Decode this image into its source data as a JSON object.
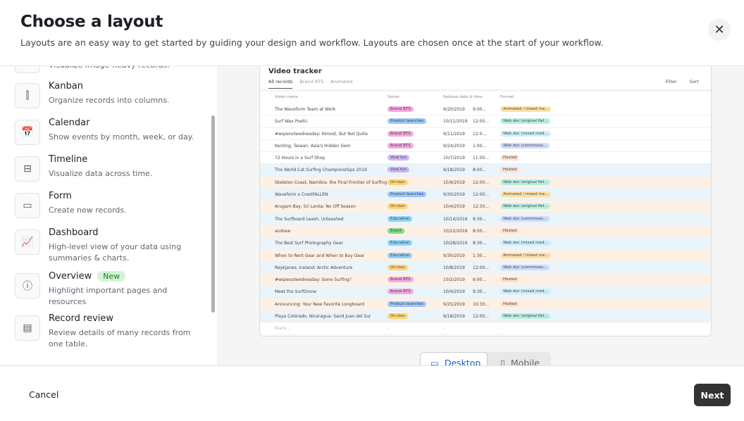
{
  "header": {
    "title": "Choose a layout",
    "subtitle": "Layouts are an easy way to get started by guiding your design and workflow. Layouts are chosen once at the start of your workflow.",
    "close_icon": "close-icon"
  },
  "layouts": [
    {
      "name": "",
      "desc": "Visualize image-heavy records.",
      "icon": "gallery-icon"
    },
    {
      "name": "Kanban",
      "desc": "Organize records into columns.",
      "icon": "kanban-icon"
    },
    {
      "name": "Calendar",
      "desc": "Show events by month, week, or day.",
      "icon": "calendar-icon"
    },
    {
      "name": "Timeline",
      "desc": "Visualize data across time.",
      "icon": "timeline-icon"
    },
    {
      "name": "Form",
      "desc": "Create new records.",
      "icon": "form-icon"
    },
    {
      "name": "Dashboard",
      "desc": "High-level view of your data using summaries & charts.",
      "icon": "dashboard-icon"
    },
    {
      "name": "Overview",
      "badge": "New",
      "desc": "Highlight important pages and resources",
      "icon": "info-icon"
    },
    {
      "name": "Record review",
      "desc": "Review details of many records from one table.",
      "icon": "record-review-icon"
    }
  ],
  "preview": {
    "title": "Video tracker",
    "tabs": [
      "All records",
      "Brand BTS",
      "Animated"
    ],
    "actions": [
      "Filter",
      "Sort"
    ],
    "columns": [
      "Video name",
      "Series",
      "Release date & time",
      "Format"
    ],
    "rows": [
      [
        "The Waveform Team at Work",
        "Brand BTS",
        "9/20/2019",
        "9:00...",
        "Animated / mixed me..."
      ],
      [
        "Surf Wax Poetic",
        "Product launches",
        "10/11/2019",
        "12:00...",
        "Web doc (original fiel..."
      ],
      [
        "#wipeoutwednesday: Almost, But Not Quite",
        "Brand BTS",
        "9/11/2019",
        "12:0...",
        "Web doc (mixed med..."
      ],
      [
        "Kenting, Taiwan: Asia's Hidden Gem",
        "Brand BTS",
        "9/24/2019",
        "1:00...",
        "Web doc (commissio..."
      ],
      [
        "72 Hours in a Surf Shop",
        "Viral fun",
        "10/7/2019",
        "11:00...",
        "Hosted"
      ],
      [
        "The World Cat Surfing Championships 2019",
        "Viral fun",
        "9/18/2019",
        "8:00...",
        "Hosted"
      ],
      [
        "Skeleton Coast, Namibia: the Final Frontier of Surfing",
        "On tour",
        "10/9/2019",
        "12:00...",
        "Web doc (original fiel..."
      ],
      [
        "Waveform x CrestFALLEN",
        "Product launches",
        "9/30/2019",
        "12:00...",
        "Animated / mixed me..."
      ],
      [
        "Arugam Bay, Sri Lanka: No Off Season",
        "On tour",
        "10/4/2019",
        "12:30...",
        "Web doc (original fiel..."
      ],
      [
        "The Surfboard Leash, Unleashed",
        "Education",
        "10/14/2019",
        "9:30...",
        "Web doc (commissio..."
      ],
      [
        "andrew",
        "Event",
        "10/22/2019",
        "8:00...",
        "Hosted"
      ],
      [
        "The Best Surf Photography Gear",
        "Education",
        "10/28/2019",
        "8:30...",
        "Web doc (mixed med..."
      ],
      [
        "When to Rent Gear and When to Buy Gear",
        "Education",
        "9/30/2019",
        "1:30...",
        "Animated / mixed me..."
      ],
      [
        "Reykjanes, Iceland: Arctic Adventure",
        "On tour",
        "10/8/2019",
        "12:00...",
        "Web doc (commissio..."
      ],
      [
        "#wipeoutwednesday: Gone Surfing?",
        "Brand BTS",
        "10/2/2019",
        "6:00...",
        "Hosted"
      ],
      [
        "Meet the SurfDrone",
        "Brand BTS",
        "10/4/2019",
        "9:30...",
        "Web doc (mixed med..."
      ],
      [
        "Announcing: Your New Favorite Longboard",
        "Product launches",
        "9/25/2019",
        "10:30...",
        "Hosted"
      ],
      [
        "Playa Colorado, Nicaragua: Sand Juan del Sur",
        "On tour",
        "9/18/2019",
        "12:00...",
        "Web doc (original fiel..."
      ],
      [
        "Blank...",
        "–",
        "–",
        "",
        "–"
      ]
    ],
    "pill_colors": {
      "Brand BTS": "#f7a8e0",
      "Product launches": "#9cc7fb",
      "Viral fun": "#cdb6f7",
      "On tour": "#fdd674",
      "Education": "#8fd3f7",
      "Event": "#86db86",
      "Animated / mixed me...": "#fde2a6",
      "Web doc (original fiel...": "#b9efe4",
      "Web doc (mixed med...": "#cdeefa",
      "Web doc (commissio...": "#cfdcfb",
      "Hosted": "#fde0d0"
    }
  },
  "view_toggle": {
    "desktop": "Desktop",
    "mobile": "Mobile",
    "selected": "Desktop"
  },
  "footer": {
    "cancel": "Cancel",
    "next": "Next"
  }
}
